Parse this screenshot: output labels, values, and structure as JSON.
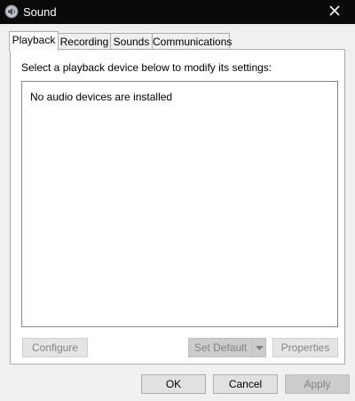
{
  "window": {
    "title": "Sound",
    "icon": "speaker-icon",
    "close_glyph": "✕"
  },
  "tabs": [
    {
      "label": "Playback",
      "active": true
    },
    {
      "label": "Recording",
      "active": false
    },
    {
      "label": "Sounds",
      "active": false
    },
    {
      "label": "Communications",
      "active": false
    }
  ],
  "playback": {
    "instruction": "Select a playback device below to modify its settings:",
    "empty_message": "No audio devices are installed",
    "configure_label": "Configure",
    "set_default_label": "Set Default",
    "properties_label": "Properties"
  },
  "footer": {
    "ok_label": "OK",
    "cancel_label": "Cancel",
    "apply_label": "Apply"
  }
}
